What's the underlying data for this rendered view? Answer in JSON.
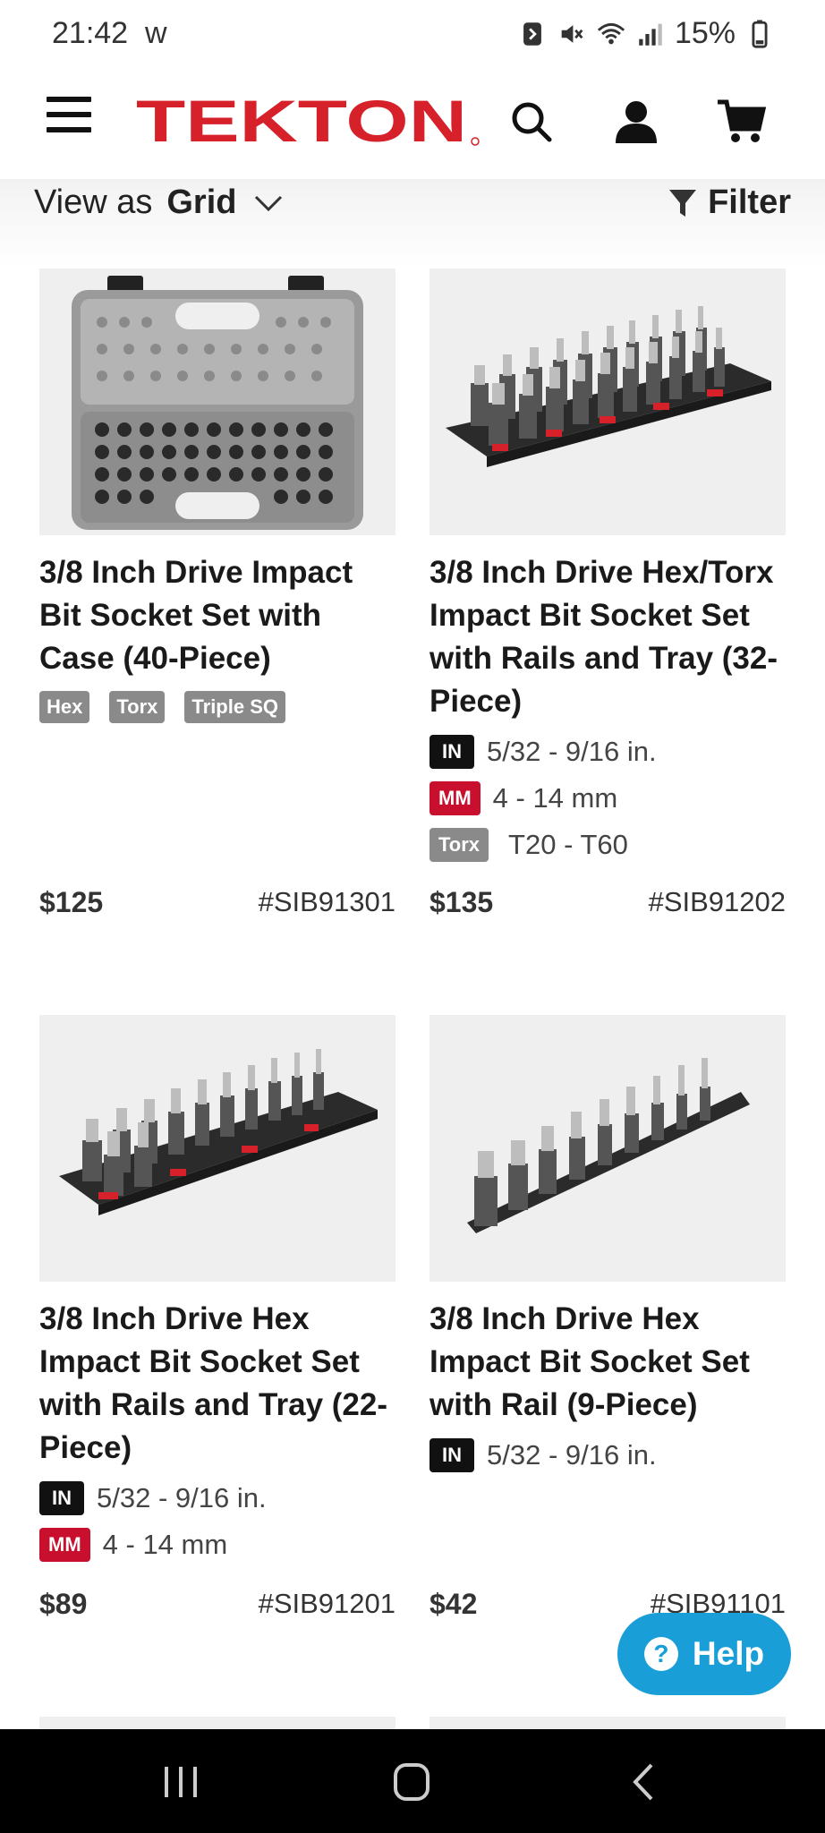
{
  "status": {
    "time": "21:42",
    "carrier": "w",
    "battery": "15%"
  },
  "header": {
    "brand": "TEKTON"
  },
  "toolbar": {
    "view_prefix": "View as",
    "view_mode": "Grid",
    "filter_label": "Filter"
  },
  "products": [
    {
      "title": "3/8 Inch Drive Impact Bit Socket Set with Case (40-Piece)",
      "tags": [
        "Hex",
        "Torx",
        "Triple SQ"
      ],
      "price": "$125",
      "sku": "#SIB91301"
    },
    {
      "title": "3/8 Inch Drive Hex/Torx Impact Bit Socket Set with Rails and Tray (32-Piece)",
      "specs": [
        {
          "badge": "IN",
          "text": "5/32 - 9/16 in."
        },
        {
          "badge": "MM",
          "text": "4 - 14 mm"
        },
        {
          "badge": "Torx",
          "text": "T20 - T60"
        }
      ],
      "price": "$135",
      "sku": "#SIB91202"
    },
    {
      "title": "3/8 Inch Drive Hex Impact Bit Socket Set with Rails and Tray (22-Piece)",
      "specs": [
        {
          "badge": "IN",
          "text": "5/32 - 9/16 in."
        },
        {
          "badge": "MM",
          "text": "4 - 14 mm"
        }
      ],
      "price": "$89",
      "sku": "#SIB91201"
    },
    {
      "title": "3/8 Inch Drive Hex Impact Bit Socket Set with Rail (9-Piece)",
      "specs": [
        {
          "badge": "IN",
          "text": "5/32 - 9/16 in."
        }
      ],
      "price": "$42",
      "sku": "#SIB91101"
    }
  ],
  "help": {
    "label": "Help"
  },
  "colors": {
    "brand_red": "#d6202a",
    "help_blue": "#1a9ed8",
    "mm_red": "#c8102e"
  }
}
